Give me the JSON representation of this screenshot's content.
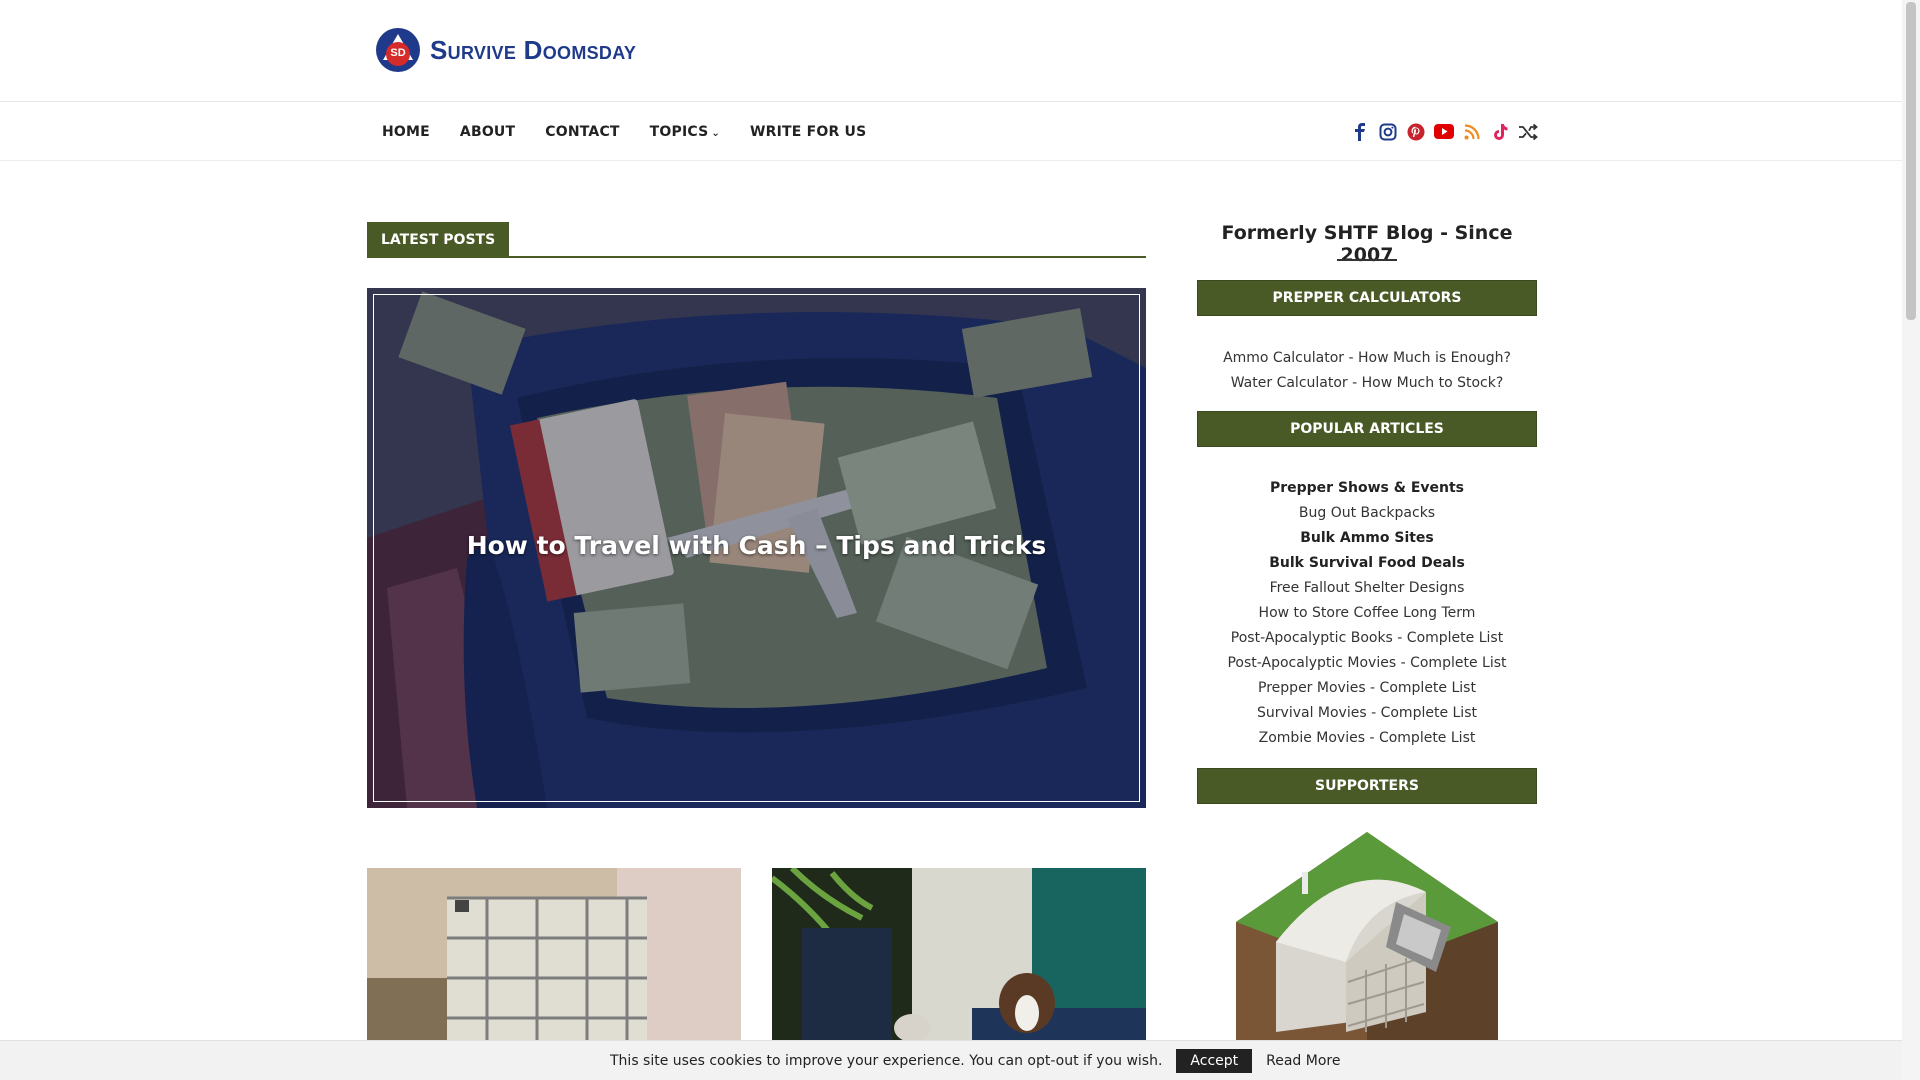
{
  "brand": {
    "name": "Survive Doomsday",
    "badge": "SD",
    "primary_color": "#1f3a8a",
    "accent_color": "#4a5a26"
  },
  "nav": {
    "items": [
      {
        "label": "HOME"
      },
      {
        "label": "ABOUT"
      },
      {
        "label": "CONTACT"
      },
      {
        "label": "TOPICS",
        "has_dropdown": true
      },
      {
        "label": "WRITE FOR US"
      }
    ],
    "social_icons": [
      "facebook-icon",
      "instagram-icon",
      "pinterest-icon",
      "youtube-icon",
      "rss-icon",
      "tiktok-icon",
      "shuffle-icon"
    ]
  },
  "main": {
    "section_label": "LATEST POSTS",
    "featured_post": {
      "title": "How to Travel with Cash – Tips and Tricks"
    }
  },
  "sidebar": {
    "tagline": "Formerly SHTF Blog - Since 2007",
    "calculators": {
      "heading": "PREPPER CALCULATORS",
      "links": [
        "Ammo Calculator - How Much is Enough?",
        "Water Calculator - How Much to Stock?"
      ]
    },
    "popular": {
      "heading": "POPULAR ARTICLES",
      "links": [
        {
          "label": "Prepper Shows & Events",
          "bold": true
        },
        {
          "label": "Bug Out Backpacks",
          "bold": false
        },
        {
          "label": "Bulk Ammo Sites",
          "bold": true
        },
        {
          "label": "Bulk Survival Food Deals",
          "bold": true
        },
        {
          "label": "Free Fallout Shelter Designs",
          "bold": false
        },
        {
          "label": "How to Store Coffee Long Term",
          "bold": false
        },
        {
          "label": "Post-Apocalyptic Books - Complete List",
          "bold": false
        },
        {
          "label": "Post-Apocalyptic Movies - Complete List",
          "bold": false
        },
        {
          "label": "Prepper Movies - Complete List",
          "bold": false
        },
        {
          "label": "Survival Movies - Complete List",
          "bold": false
        },
        {
          "label": "Zombie Movies - Complete List",
          "bold": false
        }
      ]
    },
    "supporters": {
      "heading": "SUPPORTERS"
    }
  },
  "cookie": {
    "text": "This site uses cookies to improve your experience. You can opt-out if you wish.",
    "accept": "Accept",
    "read_more": "Read More"
  }
}
